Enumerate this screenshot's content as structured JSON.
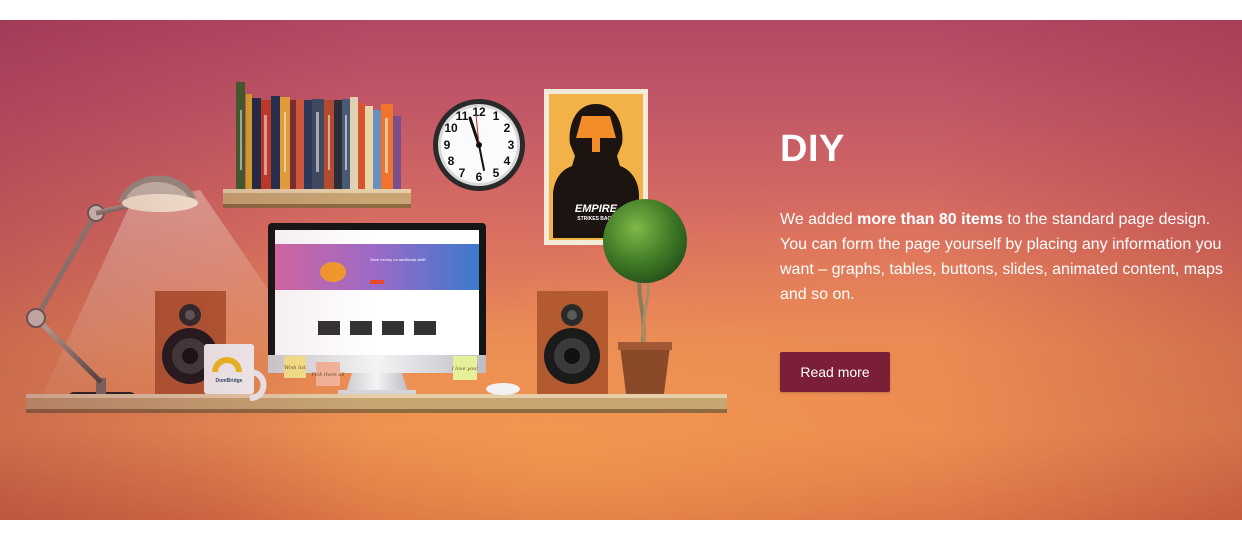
{
  "hero": {
    "title": "DIY",
    "description_pre": "We added ",
    "description_bold": "more than 80 items",
    "description_post": " to the standard page design. You can form the page yourself by placing any information you want – graphs, tables, buttons, slides, animated content, maps and so on.",
    "button_label": "Read more"
  },
  "scene": {
    "mug_brand": "DomBridge",
    "monitor_headline": "Save money on additional staff!",
    "poster_title": "EMPIRE",
    "poster_subtitle": "STRIKES BACK",
    "notes": [
      "Wish list",
      "Pick them all",
      "I love you!"
    ],
    "clock_numbers": [
      "12",
      "1",
      "2",
      "3",
      "4",
      "5",
      "6",
      "7",
      "8",
      "9",
      "10",
      "11"
    ]
  },
  "colors": {
    "button_bg": "#7b1e37",
    "banner_top": "#b24863",
    "banner_bottom": "#ec8e52"
  }
}
